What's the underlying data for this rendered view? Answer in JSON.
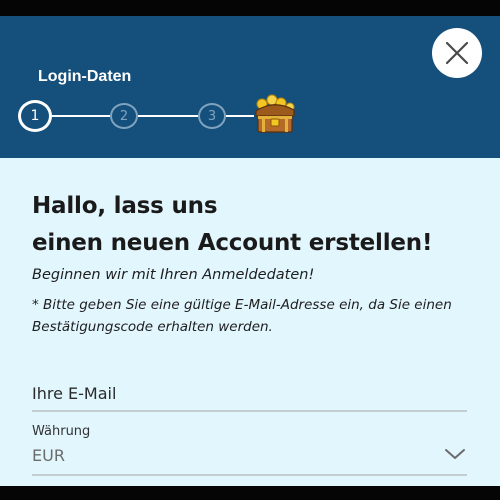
{
  "colors": {
    "header_bg": "#15507c",
    "content_bg": "#e2f6fe",
    "field_underline": "#c3cdd2"
  },
  "icons": {
    "close": "close-icon",
    "chest": "treasure-chest-icon",
    "chevron": "chevron-down-icon"
  },
  "header": {
    "step_title": "Login-Daten",
    "steps": [
      {
        "label": "1",
        "state": "active"
      },
      {
        "label": "2",
        "state": "inactive"
      },
      {
        "label": "3",
        "state": "inactive"
      }
    ]
  },
  "main": {
    "headline_line1": "Hallo, lass uns",
    "headline_line2": "einen neuen Account erstellen!",
    "intro": "Beginnen wir mit Ihren Anmeldedaten!",
    "note": "* Bitte geben Sie eine gültige E-Mail-Adresse ein, da Sie einen Bestätigungscode erhalten werden."
  },
  "form": {
    "email_placeholder": "Ihre E-Mail",
    "email_value": "",
    "currency_label": "Währung",
    "currency_value": "EUR"
  }
}
